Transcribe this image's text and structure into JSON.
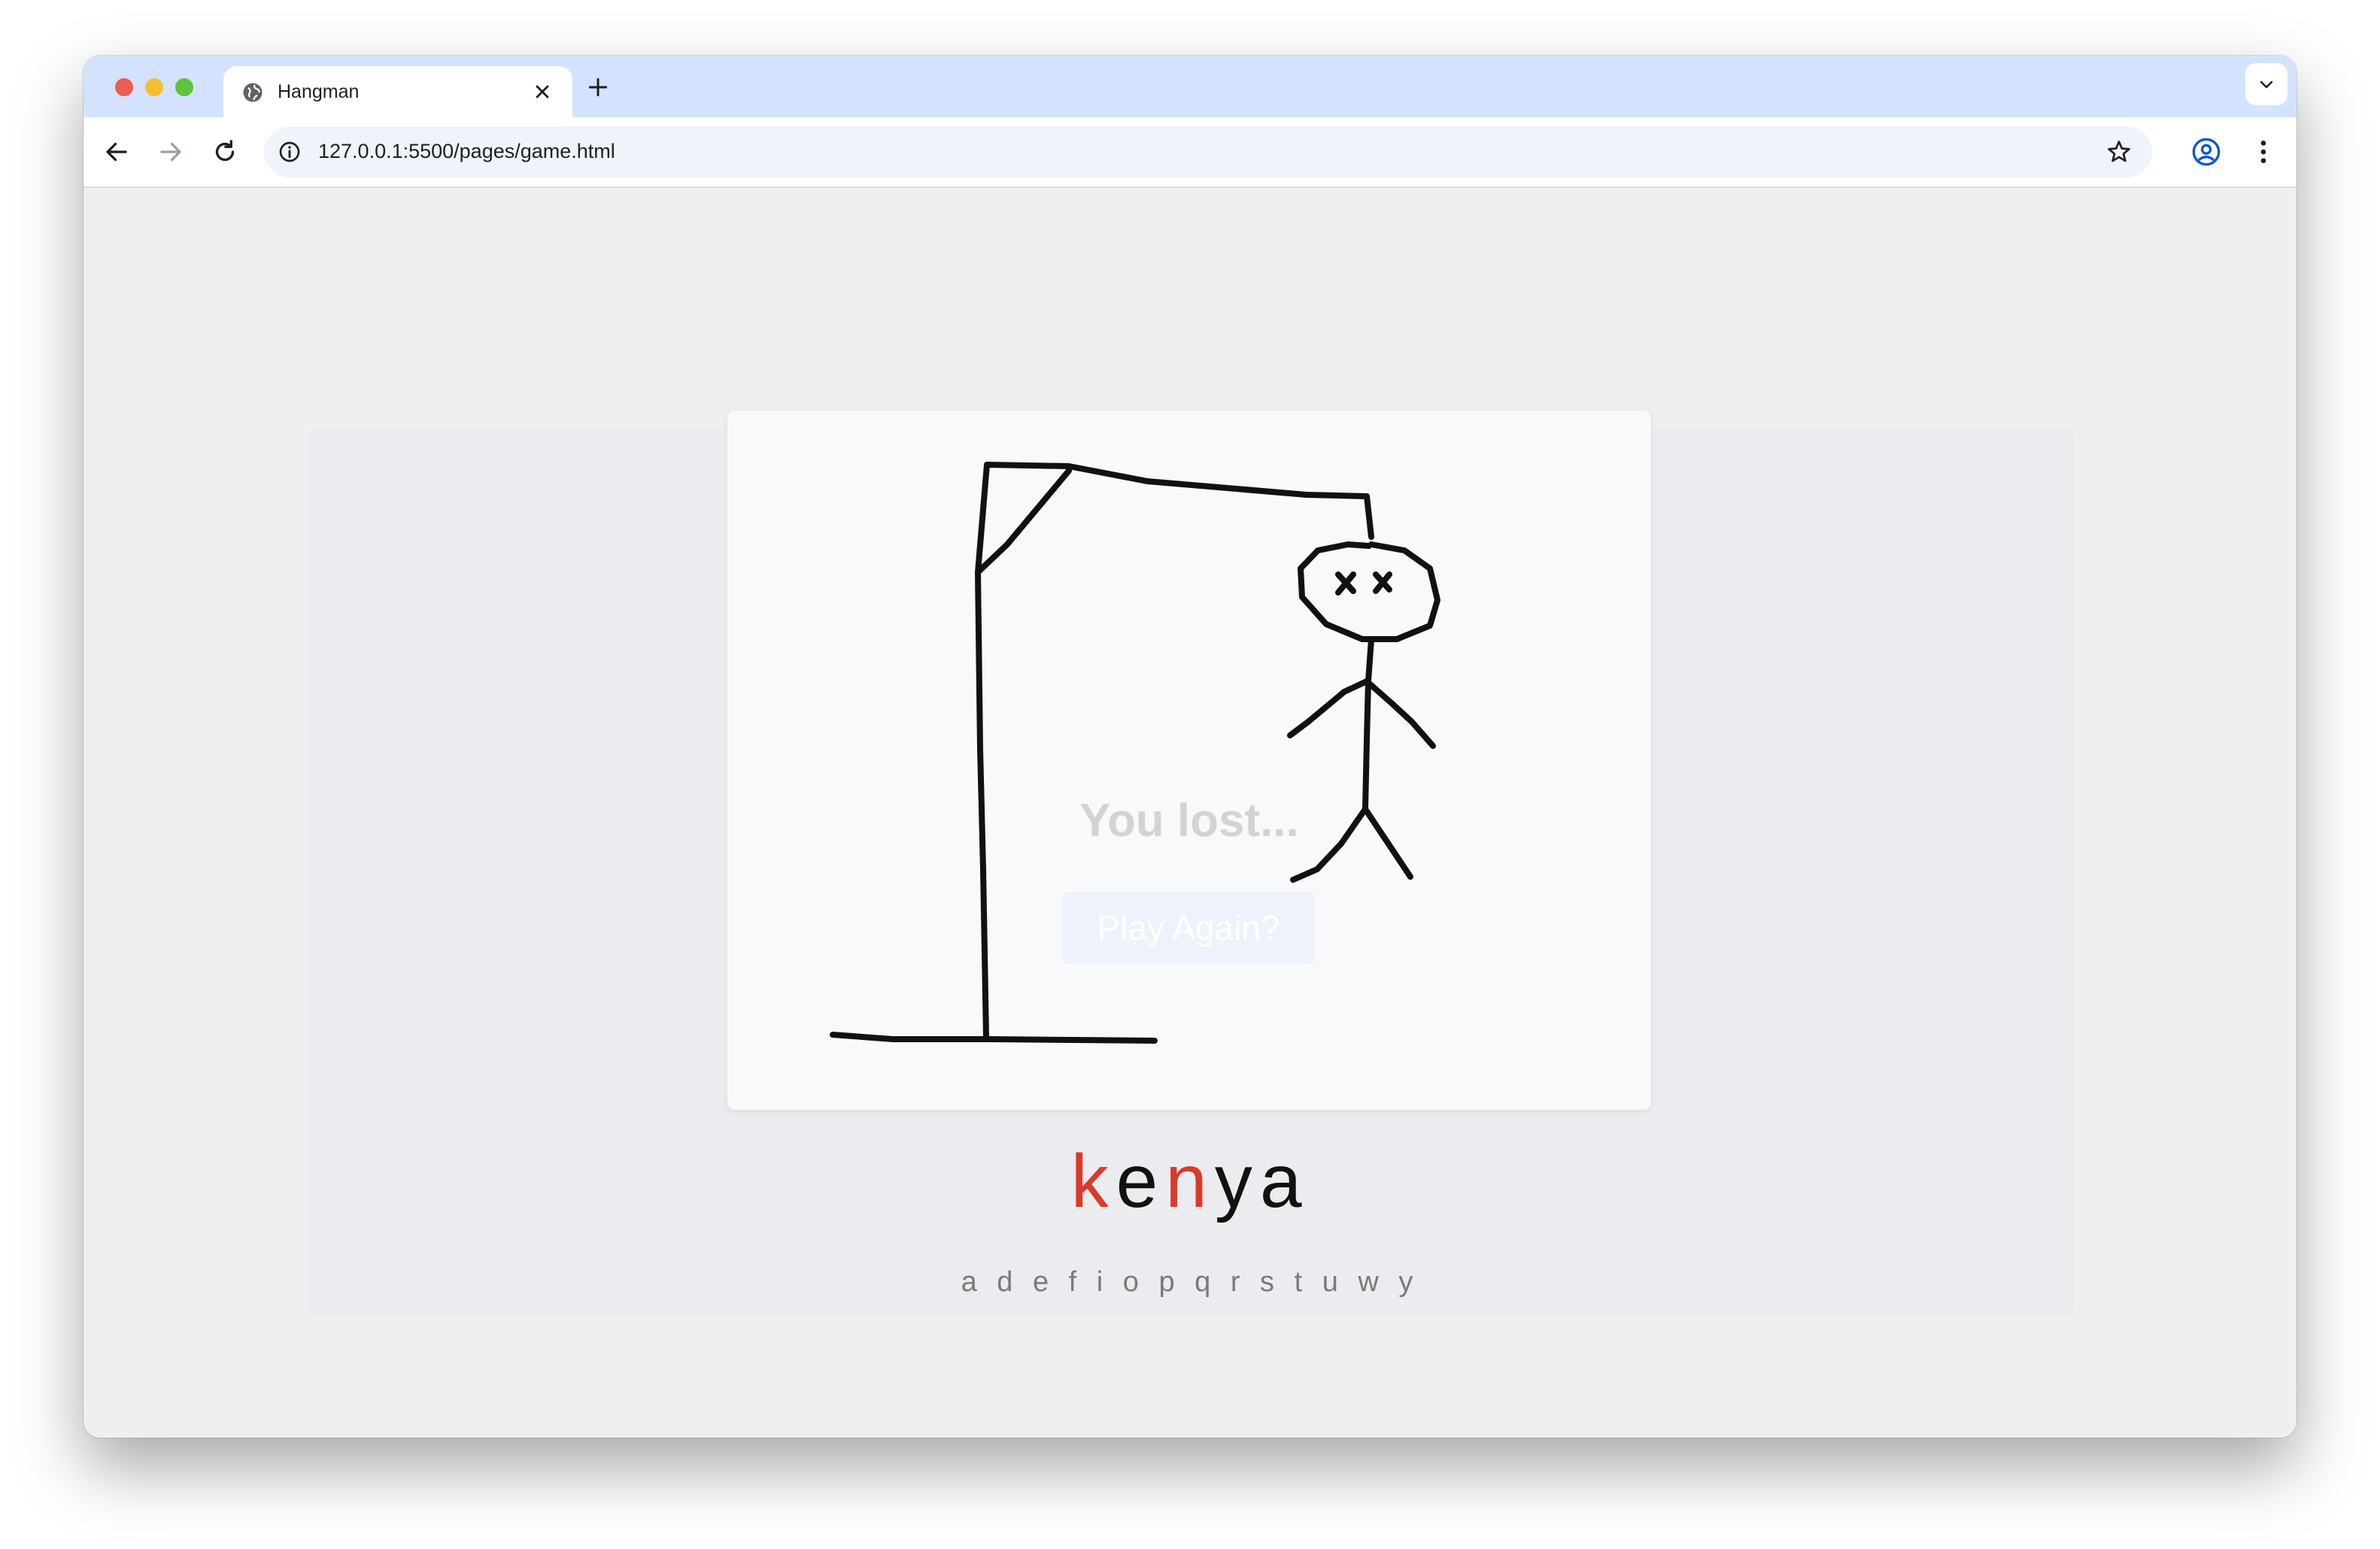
{
  "browser": {
    "tab": {
      "title": "Hangman"
    },
    "address_bar": {
      "url": "127.0.0.1:5500/pages/game.html"
    },
    "icons": {
      "back": "arrow-left-icon",
      "forward": "arrow-right-icon",
      "reload": "reload-icon",
      "site_info": "info-icon",
      "bookmark": "star-icon",
      "profile": "profile-icon",
      "menu": "kebab-menu-icon"
    }
  },
  "game": {
    "result_message": "You lost...",
    "play_again_label": "Play Again?",
    "word_letters": [
      {
        "char": "k",
        "color": "#d93a2b"
      },
      {
        "char": "e",
        "color": "#111111"
      },
      {
        "char": "n",
        "color": "#d93a2b"
      },
      {
        "char": "y",
        "color": "#111111"
      },
      {
        "char": "a",
        "color": "#111111"
      }
    ],
    "guessed_letters": "a d e f i o p q r s t u w y",
    "missed_color": "#d93a2b",
    "found_color": "#111111"
  }
}
